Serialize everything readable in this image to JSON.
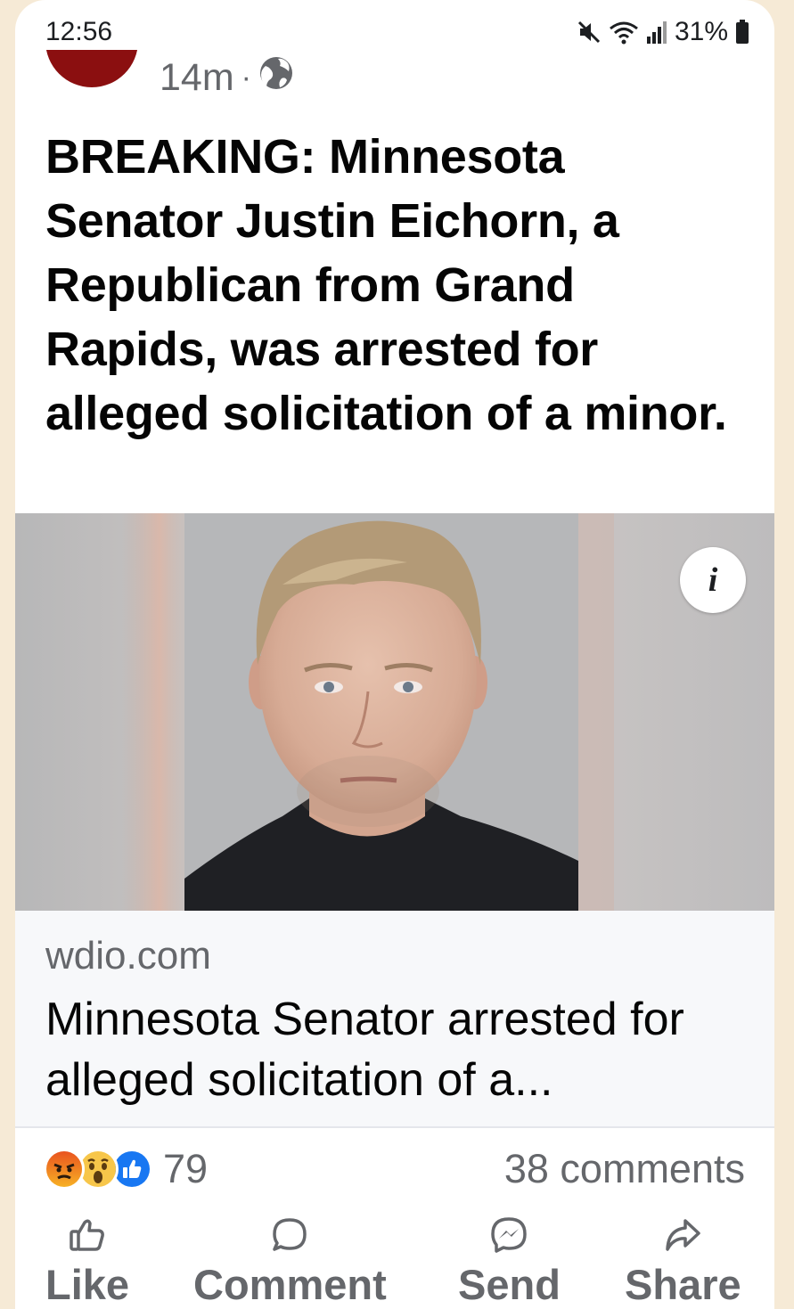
{
  "status_bar": {
    "time": "12:56",
    "battery": "31%",
    "icons": [
      "mute-icon",
      "wifi-icon",
      "signal-icon",
      "battery-icon"
    ]
  },
  "post": {
    "time_ago": "14m",
    "separator": "·",
    "audience_icon": "globe-icon",
    "headline": "BREAKING: Minnesota Senator Justin Eichorn, a Republican from Grand Rapids, was arrested for alleged solicitation of a minor."
  },
  "photo": {
    "info_label": "i"
  },
  "link_preview": {
    "domain": "wdio.com",
    "title": "Minnesota Senator arrested for alleged solicitation of a..."
  },
  "engagement": {
    "reactions": [
      "angry",
      "wow",
      "like"
    ],
    "reaction_count": "79",
    "comments": "38 comments"
  },
  "actions": {
    "like": "Like",
    "comment": "Comment",
    "send": "Send",
    "share": "Share"
  },
  "colors": {
    "background": "#f6ead6",
    "avatar": "#8b0f10",
    "like_blue": "#1877f2",
    "muted_text": "#65676b"
  }
}
